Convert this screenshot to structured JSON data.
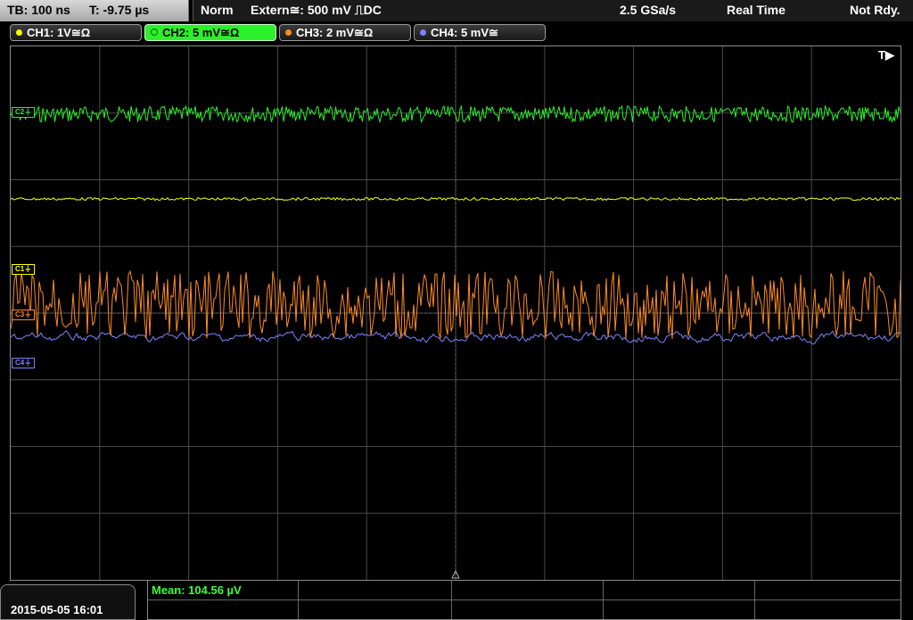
{
  "topbar": {
    "timebase": "TB: 100 ns",
    "trigger_time": "T: -9.75 µs",
    "trigger_mode": "Norm",
    "trigger_source": "Extern≅: 500 mV ⎍DC",
    "sample_rate": "2.5 GSa/s",
    "acq_mode": "Real Time",
    "status": "Not Rdy."
  },
  "channels": [
    {
      "label": "CH1: 1V≅Ω",
      "color": "#ffff00",
      "marker": "C1⏚"
    },
    {
      "label": "CH2: 5 mV≅Ω",
      "color": "#2cf02c",
      "marker": "C2⏚"
    },
    {
      "label": "CH3: 2 mV≅Ω",
      "color": "#ff8c20",
      "marker": "C3⏚"
    },
    {
      "label": "CH4: 5 mV≅",
      "color": "#8080ff",
      "marker": "C4⏚"
    }
  ],
  "trigger_marker": "T▶",
  "measurement": {
    "mean": "Mean: 104.56 µV"
  },
  "datetime": "2015-05-05 16:01",
  "colors": {
    "ch1": "#ffff00",
    "ch2": "#2cf02c",
    "ch3": "#ff8c20",
    "ch4": "#8080ff",
    "grid": "#4a4a4a"
  }
}
